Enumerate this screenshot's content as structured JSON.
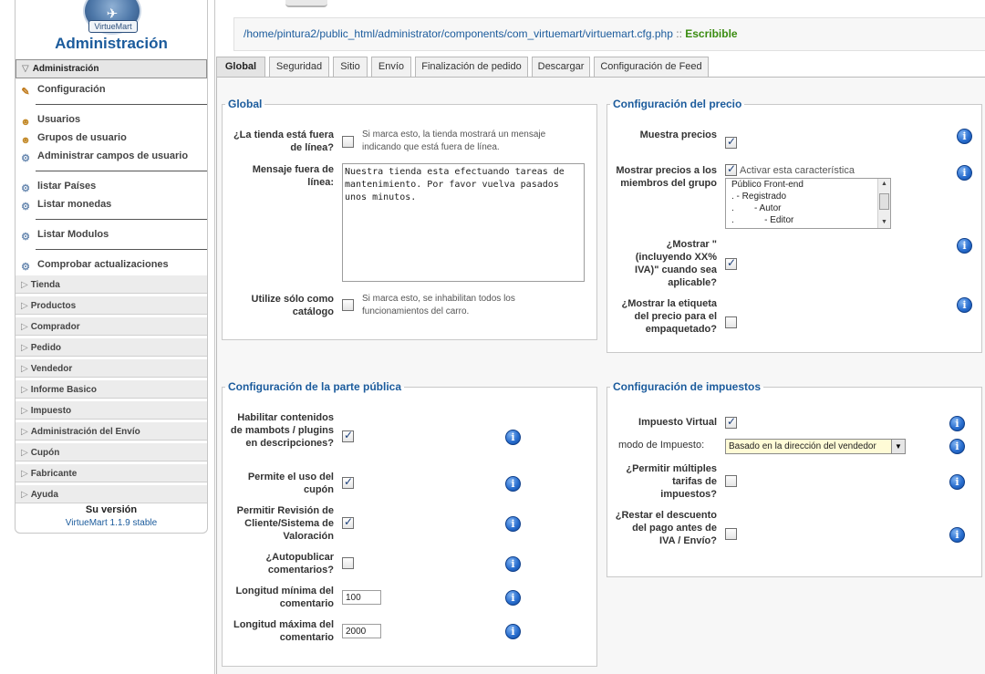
{
  "sidebar": {
    "logo_text": "VirtueMart",
    "title": "Administración",
    "section_header": "Administración",
    "links": [
      {
        "label": "Configuración"
      },
      {
        "label": "Usuarios"
      },
      {
        "label": "Grupos de usuario"
      },
      {
        "label": "Administrar campos de usuario"
      },
      {
        "label": "listar Países"
      },
      {
        "label": "Listar monedas"
      },
      {
        "label": "Listar Modulos"
      },
      {
        "label": "Comprobar actualizaciones"
      }
    ],
    "categories": [
      "Tienda",
      "Productos",
      "Comprador",
      "Pedido",
      "Vendedor",
      "Informe Basico",
      "Impuesto",
      "Administración del Envío",
      "Cupón",
      "Fabricante",
      "Ayuda"
    ],
    "version_title": "Su versión",
    "version_value": "VirtueMart 1.1.9 stable"
  },
  "path_bar": {
    "path": "/home/pintura2/public_html/administrator/components/com_virtuemart/virtuemart.cfg.php",
    "separator": "::",
    "status": "Escribible"
  },
  "tabs": [
    "Global",
    "Seguridad",
    "Sitio",
    "Envío",
    "Finalización de pedido",
    "Descargar",
    "Configuración de Feed"
  ],
  "global": {
    "legend": "Global",
    "offline_label": "¿La tienda está fuera de línea?",
    "offline_desc": "Si marca esto, la tienda mostrará un mensaje indicando que está fuera de línea.",
    "offline_checked": false,
    "offline_msg_label": "Mensaje fuera de línea:",
    "offline_msg_value": "Nuestra tienda esta efectuando tareas de mantenimiento. Por favor vuelva pasados unos minutos.",
    "catalog_label": "Utilize sólo como catálogo",
    "catalog_desc": "Si marca esto, se inhabilitan todos los funcionamientos del carro.",
    "catalog_checked": false
  },
  "price": {
    "legend": "Configuración del precio",
    "show_prices_label": "Muestra precios",
    "show_prices_checked": true,
    "members_label": "Mostrar precios a los miembros del grupo",
    "members_checked": true,
    "members_enable_label": "Activar esta característica",
    "groups": [
      "Público Front-end",
      ". - Registrado",
      ".        - Autor",
      ".            - Editor"
    ],
    "incl_tax_label": "¿Mostrar \"(incluyendo XX% IVA)\" cuando sea aplicable?",
    "incl_tax_checked": true,
    "pack_label": "¿Mostrar la etiqueta del precio para el empaquetado?",
    "pack_checked": false
  },
  "public": {
    "legend": "Configuración de la parte pública",
    "mambots_label": "Habilitar contenidos de mambots / plugins en descripciones?",
    "mambots_checked": true,
    "coupon_label": "Permite el uso del cupón",
    "coupon_checked": true,
    "review_label": "Permitir Revisión de Cliente/Sistema de Valoración",
    "review_checked": true,
    "autopub_label": "¿Autopublicar comentarios?",
    "autopub_checked": false,
    "min_len_label": "Longitud mínima del comentario",
    "min_len_value": "100",
    "max_len_label": "Longitud máxima del comentario",
    "max_len_value": "2000"
  },
  "tax": {
    "legend": "Configuración de impuestos",
    "virtual_label": "Impuesto Virtual",
    "virtual_checked": true,
    "mode_label": "modo de Impuesto:",
    "mode_value": "Basado en la dirección del vendedor",
    "multi_label": "¿Permitir múltiples tarifas de impuestos?",
    "multi_checked": false,
    "discount_label": "¿Restar el descuento del pago antes de IVA / Envío?",
    "discount_checked": false
  },
  "icons": {
    "help": "info-icon",
    "help_glyph": "i"
  }
}
